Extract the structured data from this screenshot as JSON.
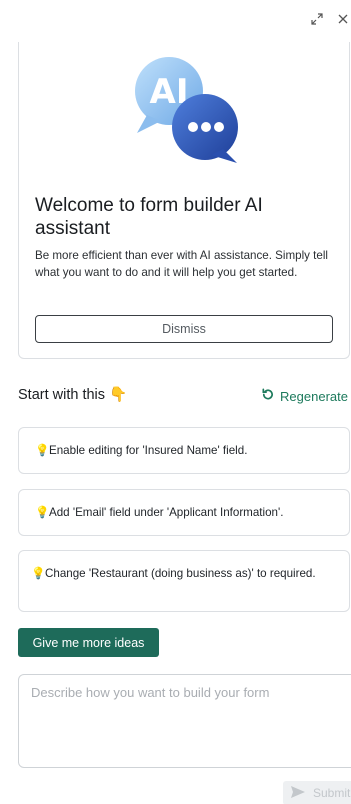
{
  "window": {
    "expand_icon": "expand-icon",
    "close_icon": "close-icon"
  },
  "welcome": {
    "illustration_text": "AI",
    "title": "Welcome to form builder AI assistant",
    "description": "Be more efficient than ever with AI assistance. Simply tell what you want to do and it will help you get started.",
    "dismiss_label": "Dismiss"
  },
  "start": {
    "label": "Start with this",
    "emoji": "👇",
    "regenerate_label": "Regenerate"
  },
  "suggestions": [
    {
      "icon": "💡",
      "text": "Enable editing for 'Insured Name' field."
    },
    {
      "icon": "💡",
      "text": "Add 'Email' field under 'Applicant Information'."
    },
    {
      "icon": "💡",
      "text": "Change 'Restaurant (doing business as)' to required."
    }
  ],
  "more_ideas_label": "Give me more ideas",
  "prompt": {
    "value": "",
    "placeholder": "Describe how you want to build your form"
  },
  "submit_label": "Submit",
  "colors": {
    "accent_green": "#1e6b5a",
    "regenerate_green": "#1d7a5c",
    "ai_badge_light": "#8ec3f0",
    "ai_badge_dark": "#2e57b8"
  }
}
